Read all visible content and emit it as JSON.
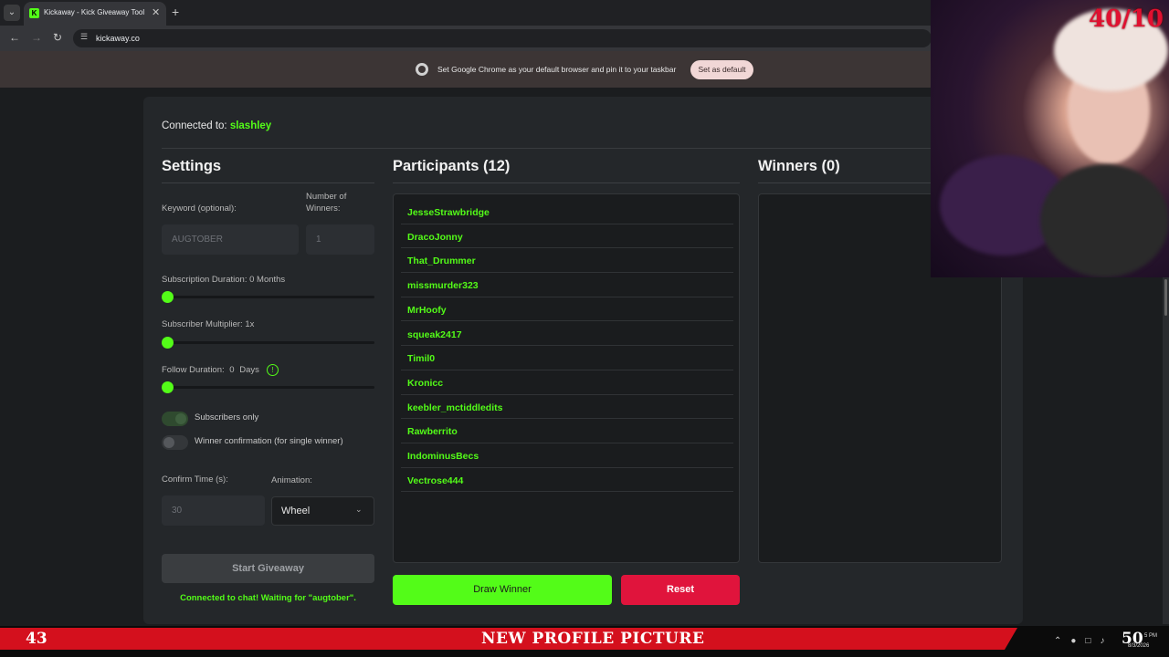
{
  "browser": {
    "tab_title": "Kickaway - Kick Giveaway Tool",
    "url": "kickaway.co",
    "infobar_text": "Set Google Chrome as your default browser and pin it to your taskbar",
    "infobar_button": "Set as default",
    "icons": [
      "tab-menu-icon",
      "close-icon",
      "new-tab-icon",
      "back-icon",
      "forward-icon",
      "reload-icon",
      "site-info-icon",
      "chrome-logo-icon"
    ]
  },
  "app": {
    "connected_prefix": "Connected to:",
    "connected_user": "slashley",
    "settings": {
      "title": "Settings",
      "keyword_label": "Keyword (optional):",
      "keyword_value": "AUGTOBER",
      "winners_label": "Number of Winners:",
      "winners_value": "1",
      "sub_duration_label": "Subscription Duration: 0 Months",
      "sub_duration_value": 0,
      "multiplier_label": "Subscriber Multiplier: 1x",
      "multiplier_value": 1,
      "follow_label": "Follow Duration:",
      "follow_value": "0",
      "follow_unit": "Days",
      "follow_info_icon": "!",
      "subscribers_only_label": "Subscribers only",
      "subscribers_only_on": true,
      "winner_confirm_label": "Winner confirmation (for single winner)",
      "winner_confirm_on": false,
      "confirm_time_label": "Confirm Time (s):",
      "confirm_time_value": "30",
      "animation_label": "Animation:",
      "animation_value": "Wheel",
      "start_button": "Start Giveaway",
      "status_text": "Connected to chat! Waiting for \"augtober\"."
    },
    "participants": {
      "title": "Participants (12)",
      "names": [
        "JesseStrawbridge",
        "DracoJonny",
        "That_Drummer",
        "missmurder323",
        "MrHoofy",
        "squeak2417",
        "Timil0",
        "Kronicc",
        "keebler_mctiddledits",
        "Rawberrito",
        "IndominusBecs",
        "Vectrose444"
      ]
    },
    "winners": {
      "title": "Winners (0)"
    },
    "draw_button": "Draw Winner",
    "reset_button": "Reset"
  },
  "overlay": {
    "webcam_counter": "40/10",
    "ticker_left": "43",
    "ticker_title": "NEW PROFILE PICTURE",
    "ticker_right": "50",
    "clock_time": "5 PM",
    "clock_date": "8/3/2026"
  },
  "colors": {
    "accent": "#53fc18",
    "danger": "#e0143c",
    "ticker": "#d4101d"
  }
}
